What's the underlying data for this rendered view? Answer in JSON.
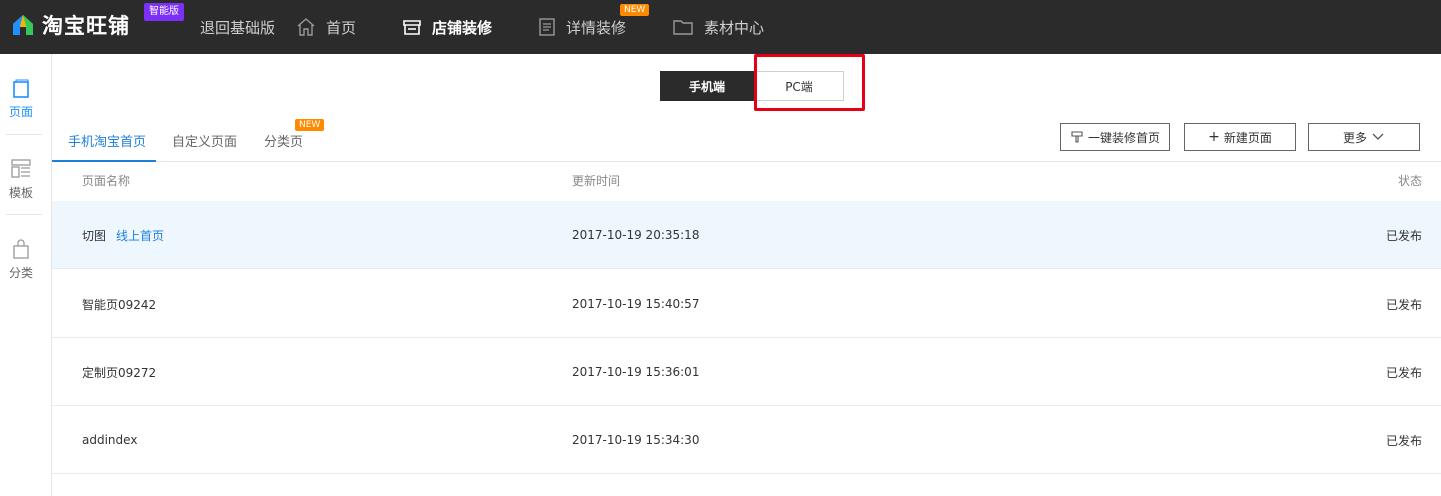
{
  "header": {
    "brand": "淘宝旺铺",
    "edition_badge": "智能版",
    "nav": {
      "back_basic": "退回基础版",
      "home": "首页",
      "shop_decor": "店铺装修",
      "detail_decor": "详情装修",
      "detail_badge": "NEW",
      "material_center": "素材中心"
    }
  },
  "sidebar": {
    "items": [
      {
        "label": "页面",
        "icon": "page-icon"
      },
      {
        "label": "模板",
        "icon": "template-icon"
      },
      {
        "label": "分类",
        "icon": "bag-icon"
      }
    ]
  },
  "switch": {
    "mobile": "手机端",
    "pc": "PC端"
  },
  "tabs": {
    "items": [
      "手机淘宝首页",
      "自定义页面",
      "分类页"
    ],
    "new_badge": "NEW"
  },
  "actions": {
    "one_click": "一键装修首页",
    "new_page": "新建页面",
    "more": "更多"
  },
  "table": {
    "headers": {
      "name": "页面名称",
      "updated": "更新时间",
      "status": "状态"
    },
    "rows": [
      {
        "name": "切图",
        "link": "线上首页",
        "updated": "2017-10-19 20:35:18",
        "status": "已发布"
      },
      {
        "name": "智能页09242",
        "updated": "2017-10-19 15:40:57",
        "status": "已发布"
      },
      {
        "name": "定制页09272",
        "updated": "2017-10-19 15:36:01",
        "status": "已发布"
      },
      {
        "name": "addindex",
        "updated": "2017-10-19 15:34:30",
        "status": "已发布"
      }
    ]
  },
  "colors": {
    "topbar": "#2b2b2b",
    "accent_blue": "#1e7fd9",
    "highlight_row": "#eef6fe",
    "annotation_red": "#e60012",
    "badge_purple": "#7b2ff7",
    "badge_orange": "#ff8a00"
  }
}
